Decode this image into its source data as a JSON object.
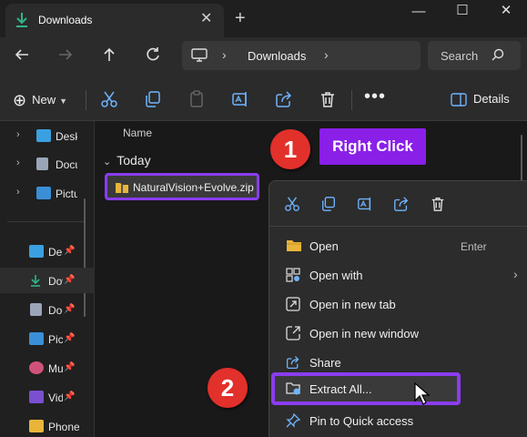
{
  "tab": {
    "title": "Downloads",
    "icon": "download-icon"
  },
  "window": {
    "new_tab": "+",
    "minimize": "—",
    "maximize": "☐",
    "close": "✕"
  },
  "address": {
    "crumb": "Downloads",
    "search_placeholder": "Search"
  },
  "toolbar": {
    "new_label": "New",
    "more_label": "•••",
    "details_label": "Details"
  },
  "sidebar": {
    "items": [
      {
        "label": "Desktop",
        "icon": "desktop-icon",
        "expandable": true
      },
      {
        "label": "Documents",
        "icon": "documents-icon",
        "expandable": true
      },
      {
        "label": "Pictures",
        "icon": "pictures-icon",
        "expandable": true
      },
      {
        "label": "Desktop",
        "icon": "desktop-icon",
        "pinned": true
      },
      {
        "label": "Downloads",
        "icon": "download-icon",
        "pinned": true,
        "selected": true
      },
      {
        "label": "Documents",
        "icon": "documents-icon",
        "pinned": true
      },
      {
        "label": "Pictures",
        "icon": "pictures-icon",
        "pinned": true
      },
      {
        "label": "Music",
        "icon": "music-icon",
        "pinned": true
      },
      {
        "label": "Videos",
        "icon": "videos-icon",
        "pinned": true
      },
      {
        "label": "Phone",
        "icon": "folder-icon"
      }
    ]
  },
  "main": {
    "column_name": "Name",
    "group_label": "Today",
    "file_name": "NaturalVision+Evolve.zip"
  },
  "annotations": {
    "step1": "1",
    "step1_label": "Right Click",
    "step2": "2",
    "accent_color": "#8a1fe8",
    "badge_color": "#e2302b"
  },
  "context_menu": {
    "items": [
      {
        "label": "Open",
        "accelerator": "Enter",
        "icon": "folder-open-icon"
      },
      {
        "label": "Open with",
        "submenu": "›",
        "icon": "open-with-icon"
      },
      {
        "label": "Open in new tab",
        "icon": "new-tab-icon"
      },
      {
        "label": "Open in new window",
        "icon": "new-window-icon"
      },
      {
        "label": "Share",
        "icon": "share-icon"
      },
      {
        "label": "Extract All...",
        "icon": "extract-icon",
        "highlighted": true
      },
      {
        "label": "Pin to Quick access",
        "icon": "pin-icon"
      }
    ]
  }
}
